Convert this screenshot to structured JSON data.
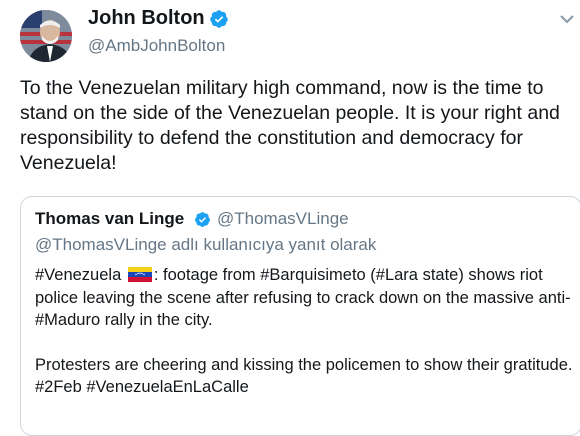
{
  "tweet": {
    "author_name": "John Bolton",
    "author_handle": "@AmbJohnBolton",
    "text": "To the Venezuelan military high command, now is the time to stand on the side of the Venezuelan people. It is your right and responsibility to defend the constitution and democracy for Venezuela!"
  },
  "quoted_tweet": {
    "author_name": "Thomas van Linge",
    "author_handle": "@ThomasVLinge",
    "reply_context": "@ThomasVLinge adlı kullanıcıya yanıt olarak",
    "text_part1": "#Venezuela",
    "text_part2": ": footage from #Barquisimeto (#Lara state) shows riot police leaving the scene after refusing to crack down on the massive anti-#Maduro rally in the city.",
    "text_paragraph2": "Protesters are cheering and kissing the policemen to show their gratitude. #2Feb #VenezuelaEnLaCalle"
  },
  "icons": {
    "verified": "verified-badge-icon",
    "menu": "chevron-down-icon",
    "flag": "venezuela-flag-icon"
  },
  "colors": {
    "verified_blue": "#1da1f2",
    "secondary_text": "#657786",
    "border": "#ccd6dd"
  }
}
